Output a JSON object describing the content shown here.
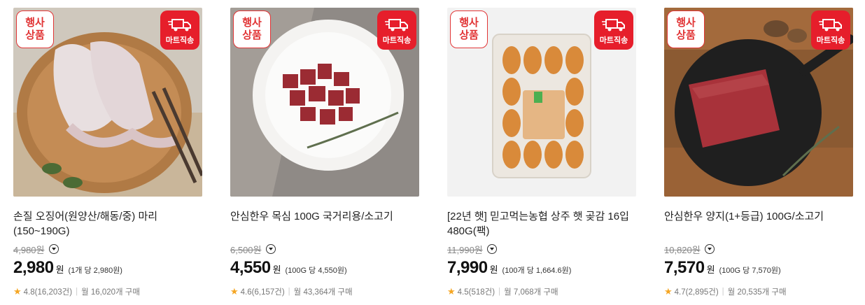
{
  "badges": {
    "event": "행사\n상품",
    "event_line1": "행사",
    "event_line2": "상품",
    "mart": "마트직송"
  },
  "products": [
    {
      "title": "손질 오징어(원양산/해동/중) 마리 (150~190G)",
      "original_price": "4,980원",
      "price": "2,980",
      "currency": "원",
      "unit_price": "(1개 당 2,980원)",
      "rating": "4.8(16,203건)",
      "monthly": "월 16,020개 구매"
    },
    {
      "title": "안심한우 목심 100G 국거리용/소고기",
      "original_price": "6,500원",
      "price": "4,550",
      "currency": "원",
      "unit_price": "(100G 당 4,550원)",
      "rating": "4.6(6,157건)",
      "monthly": "월 43,364개 구매"
    },
    {
      "title": "[22년 햇] 믿고먹는농협 상주 햇 곶감 16입 480G(팩)",
      "original_price": "11,990원",
      "price": "7,990",
      "currency": "원",
      "unit_price": "(100개 당 1,664.6원)",
      "rating": "4.5(518건)",
      "monthly": "월 7,068개 구매"
    },
    {
      "title": "안심한우 양지(1+등급) 100G/소고기",
      "original_price": "10,820원",
      "price": "7,570",
      "currency": "원",
      "unit_price": "(100G 당 7,570원)",
      "rating": "4.7(2,895건)",
      "monthly": "월 20,535개 구매"
    }
  ],
  "colors": {
    "accent_red": "#e61e2b",
    "star": "#f5a623"
  },
  "icons": [
    "truck-icon",
    "dropdown-icon",
    "star-icon"
  ]
}
